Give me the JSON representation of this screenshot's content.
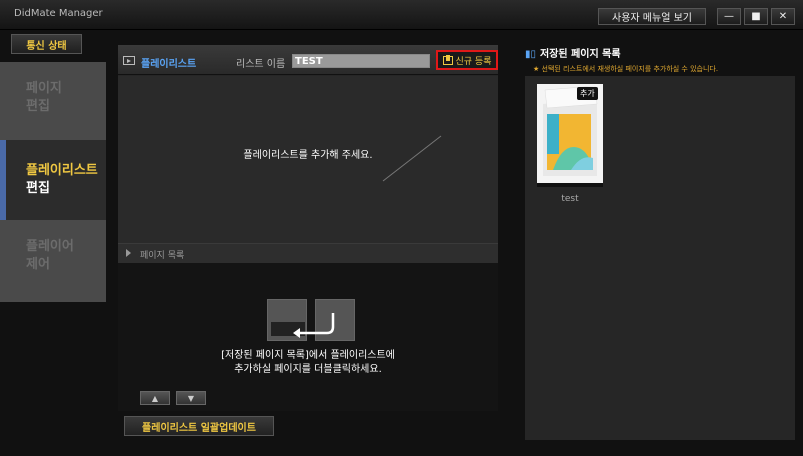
{
  "window": {
    "title": "DidMate Manager",
    "user_menu_label": "사용자 메뉴얼 보기",
    "minimize_glyph": "—",
    "maximize_glyph": "■",
    "close_glyph": "✕"
  },
  "sidebar": {
    "comm_status_label": "통신 상태",
    "items": [
      {
        "line1": "페이지",
        "line2": "편집",
        "active": false
      },
      {
        "line1": "플레이리스트",
        "line2": "편집",
        "active": true
      },
      {
        "line1": "플레이어",
        "line2": "제어",
        "active": false
      }
    ]
  },
  "playlist": {
    "header_label": "플레이리스트",
    "list_name_label": "리스트 이름",
    "list_name_value": "TEST",
    "new_button_label": "신규 등록",
    "empty_message": "플레이리스트를 추가해 주세요."
  },
  "page_list": {
    "header_label": "페이지 목록",
    "instruction_line1": "[저장된 페이지 목록]에서 플레이리스트에",
    "instruction_line2": "추가하실 페이지를 더블클릭하세요.",
    "up_glyph": "▲",
    "down_glyph": "▼"
  },
  "bulk_update_label": "플레이리스트 일괄업데이트",
  "saved_pages": {
    "title": "저장된 페이지 목록",
    "description": "★ 선택된 리스트에서 재생하실 페이지를 추가하실 수 있습니다.",
    "items": [
      {
        "name": "test",
        "badge": "추가"
      }
    ]
  },
  "colors": {
    "accent_yellow": "#f0c842",
    "accent_blue": "#5aa4f5",
    "highlight_red": "#e01818"
  }
}
